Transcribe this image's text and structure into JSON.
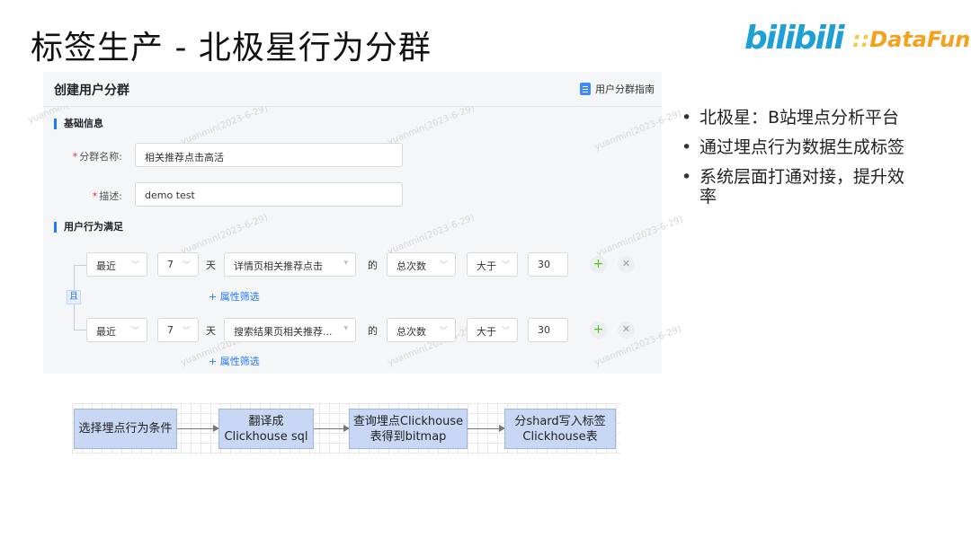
{
  "slide": {
    "title": "标签生产 - 北极星行为分群"
  },
  "logos": {
    "bilibili": "bilibili",
    "datafun_dots": "::",
    "datafun": "DataFun."
  },
  "form": {
    "title": "创建用户分群",
    "guide_link": "用户分群指南",
    "section_basic": "基础信息",
    "name_label": "分群名称:",
    "name_value": "相关推荐点击高活",
    "desc_label": "描述:",
    "desc_value": "demo test",
    "section_behavior": "用户行为满足",
    "and_label": "且",
    "rows": [
      {
        "period": "最近",
        "days": "7",
        "unit": "天",
        "event": "详情页相关推荐点击",
        "of": "的",
        "metric": "总次数",
        "op": "大于",
        "value": "30",
        "attr_link": "+ 属性筛选"
      },
      {
        "period": "最近",
        "days": "7",
        "unit": "天",
        "event": "搜索结果页相关推荐...",
        "of": "的",
        "metric": "总次数",
        "op": "大于",
        "value": "30",
        "attr_link": "+ 属性筛选"
      }
    ],
    "watermark": "yuanmin(2023-6-29)"
  },
  "bullets": [
    "北极星：B站埋点分析平台",
    "通过埋点行为数据生成标签",
    "系统层面打通对接，提升效率"
  ],
  "flow": [
    {
      "line1": "选择埋点行为条件",
      "line2": ""
    },
    {
      "line1": "翻译成",
      "line2": "Clickhouse sql"
    },
    {
      "line1": "查询埋点Clickhouse",
      "line2": "表得到bitmap"
    },
    {
      "line1": "分shard写入标签",
      "line2": "Clickhouse表"
    }
  ],
  "colors": {
    "accent": "#1f78ff",
    "required": "#f5222d",
    "add": "#52c41a",
    "flow_box": "#c8d8f4"
  }
}
